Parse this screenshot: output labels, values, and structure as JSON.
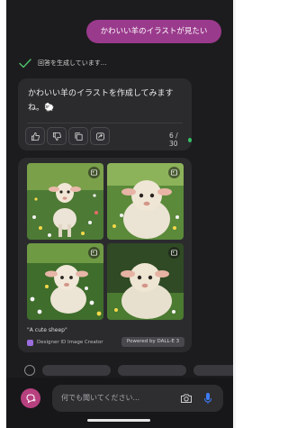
{
  "chat": {
    "user_message": "かわいい羊のイラストが見たい",
    "status_text": "回答を生成しています..."
  },
  "response": {
    "text": "かわいい羊のイラストを作成してみますね。🐑",
    "count": "6 / 30"
  },
  "images": {
    "caption": "\"A cute sheep\"",
    "creator": "Designer ID Image Creator",
    "powered_by": "Powered by DALL-E 3"
  },
  "composer": {
    "placeholder": "何でも聞いてください..."
  },
  "colors": {
    "user_bubble": "#9a3a8c",
    "accent_green": "#36c265",
    "avatar": "#b7407f"
  },
  "icons": [
    "check-icon",
    "thumbs-up-icon",
    "thumbs-down-icon",
    "copy-icon",
    "share-icon",
    "image-badge-icon",
    "designer-icon",
    "chat-avatar-icon",
    "camera-icon",
    "mic-icon"
  ]
}
